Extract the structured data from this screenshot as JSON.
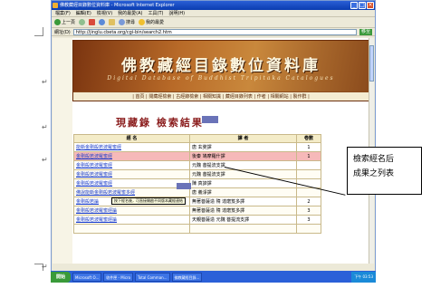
{
  "window": {
    "title": "佛教藏經目錄數位資料庫 - Microsoft Internet Explorer",
    "menu": [
      "檔案(F)",
      "編輯(E)",
      "檢視(V)",
      "我的最愛(A)",
      "工具(T)",
      "說明(H)"
    ],
    "toolbar": [
      "上一頁",
      "搜尋",
      "我的最愛"
    ],
    "address_label": "網址(D)",
    "address": "http://jinglu.cbeta.org/cgi-bin/search2.htm",
    "go_label": "移至"
  },
  "banner": {
    "title": "佛教藏經目錄數位資料庫",
    "subtitle": "Digital Database of Buddhist Tripitaka Catalogues",
    "nav": "| 首頁 | 閱藏經檢索 | 古經錄檢索 | 相關知識 | 藏經目錄列表 | 作者 | 相關網站 | 製作群 |"
  },
  "results": {
    "title": "現藏錄  檢索結果",
    "count_badge": "",
    "columns": [
      "經  名",
      "譯  者",
      "卷數"
    ],
    "rows": [
      {
        "name": "能斷金剛般若波羅蜜經",
        "translator": "唐 玄奘譯",
        "count": "1"
      },
      {
        "name": "金剛般若波羅蜜經",
        "translator": "後秦 鳩摩羅什譯",
        "count": "1"
      },
      {
        "name": "金剛般若波羅蜜經",
        "translator": "元魏 菩提流支譯",
        "count": ""
      },
      {
        "name": "金剛般若波羅蜜經",
        "translator": "元魏 菩提流支譯",
        "count": ""
      },
      {
        "name": "金剛般若波羅蜜經",
        "translator": "陳 真諦譯",
        "count": ""
      },
      {
        "name": "佛說能斷金剛般若波羅蜜多經",
        "translator": "唐 義淨譯",
        "count": ""
      },
      {
        "name": "金剛般若論",
        "translator": "無著菩薩造   隋 達磨笈多譯",
        "count": "2"
      },
      {
        "name": "金剛般若波羅蜜經論",
        "translator": "無著菩薩造   隋 達磨笈多譯",
        "count": "3"
      },
      {
        "name": "金剛般若波羅蜜經論",
        "translator": "天親菩薩造   元魏 菩提流支譯",
        "count": "3"
      },
      {
        "name": "",
        "translator": "",
        "count": ""
      }
    ],
    "tooltip": "按下經名後，可直接開啟不同版本藏經連結"
  },
  "callout": {
    "line1": "檢索經名后",
    "line2": "成果之列表"
  },
  "taskbar": {
    "start": "開始",
    "tasks": [
      "Microsoft O...",
      "收件匣 - Micro",
      "Total Comman...",
      "佛教藏經目錄..."
    ],
    "clock": "下午 03:53"
  }
}
